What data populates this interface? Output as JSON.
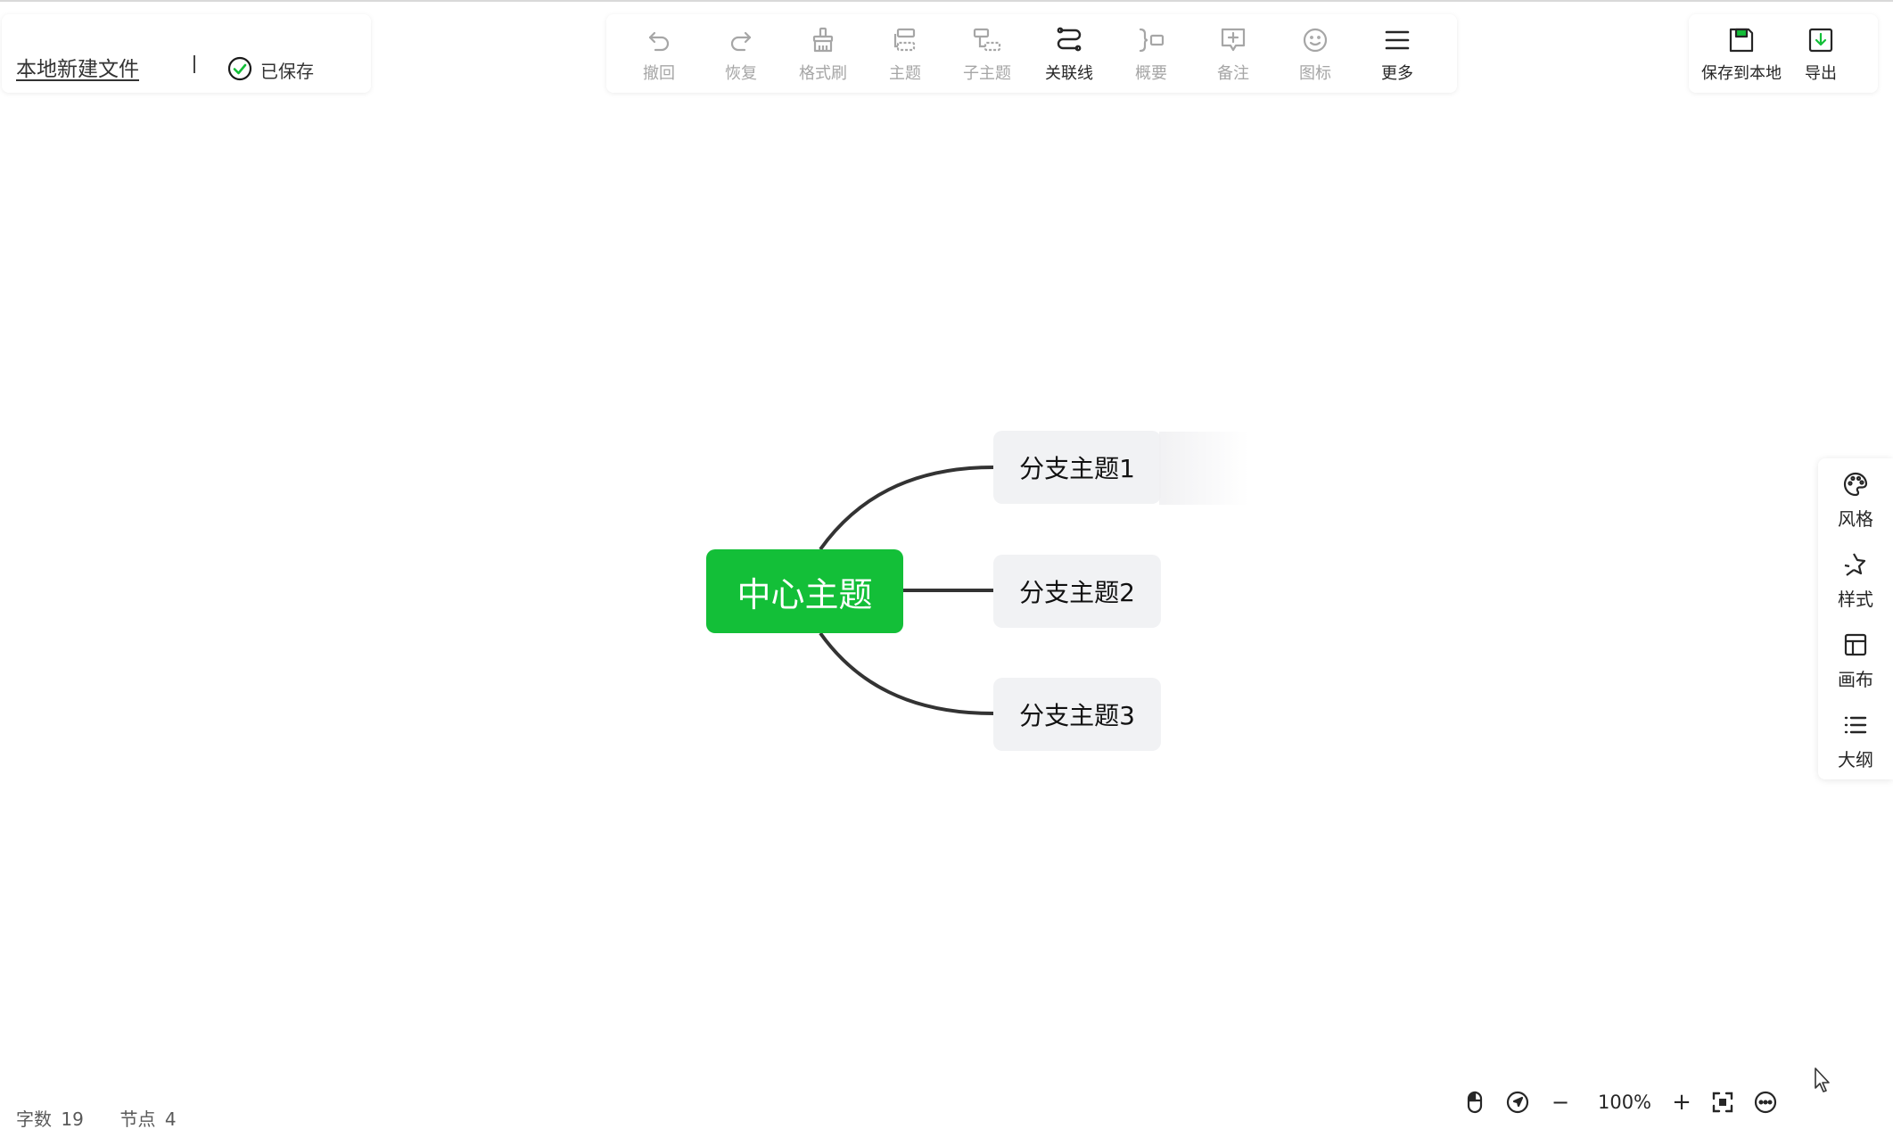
{
  "file": {
    "name": "本地新建文件",
    "separator": "|",
    "saved_status": "已保存"
  },
  "toolbar": {
    "items": [
      {
        "label": "撤回",
        "icon": "undo-icon",
        "enabled": false
      },
      {
        "label": "恢复",
        "icon": "redo-icon",
        "enabled": false
      },
      {
        "label": "格式刷",
        "icon": "format-brush-icon",
        "enabled": false
      },
      {
        "label": "主题",
        "icon": "topic-icon",
        "enabled": false
      },
      {
        "label": "子主题",
        "icon": "subtopic-icon",
        "enabled": false
      },
      {
        "label": "关联线",
        "icon": "relation-line-icon",
        "enabled": true
      },
      {
        "label": "概要",
        "icon": "summary-icon",
        "enabled": false
      },
      {
        "label": "备注",
        "icon": "note-icon",
        "enabled": false
      },
      {
        "label": "图标",
        "icon": "emoji-icon",
        "enabled": false
      },
      {
        "label": "更多",
        "icon": "menu-icon",
        "enabled": true
      }
    ]
  },
  "right_toolbar": {
    "save_local": "保存到本地",
    "export": "导出"
  },
  "mindmap": {
    "center": "中心主题",
    "branches": [
      "分支主题1",
      "分支主题2",
      "分支主题3"
    ],
    "center_color": "#13bf38",
    "branch_color": "#f1f2f4",
    "line_color": "#333333"
  },
  "side_panel": {
    "items": [
      {
        "label": "风格",
        "icon": "palette-icon"
      },
      {
        "label": "样式",
        "icon": "style-icon"
      },
      {
        "label": "画布",
        "icon": "canvas-icon"
      },
      {
        "label": "大纲",
        "icon": "outline-icon"
      }
    ]
  },
  "status": {
    "word_count_label": "字数",
    "word_count": "19",
    "node_count_label": "节点",
    "node_count": "4"
  },
  "zoom": {
    "minus": "−",
    "level": "100%",
    "plus": "+"
  },
  "colors": {
    "accent": "#13bf38",
    "disabled_text": "#a6a6a6",
    "text": "#262626"
  }
}
